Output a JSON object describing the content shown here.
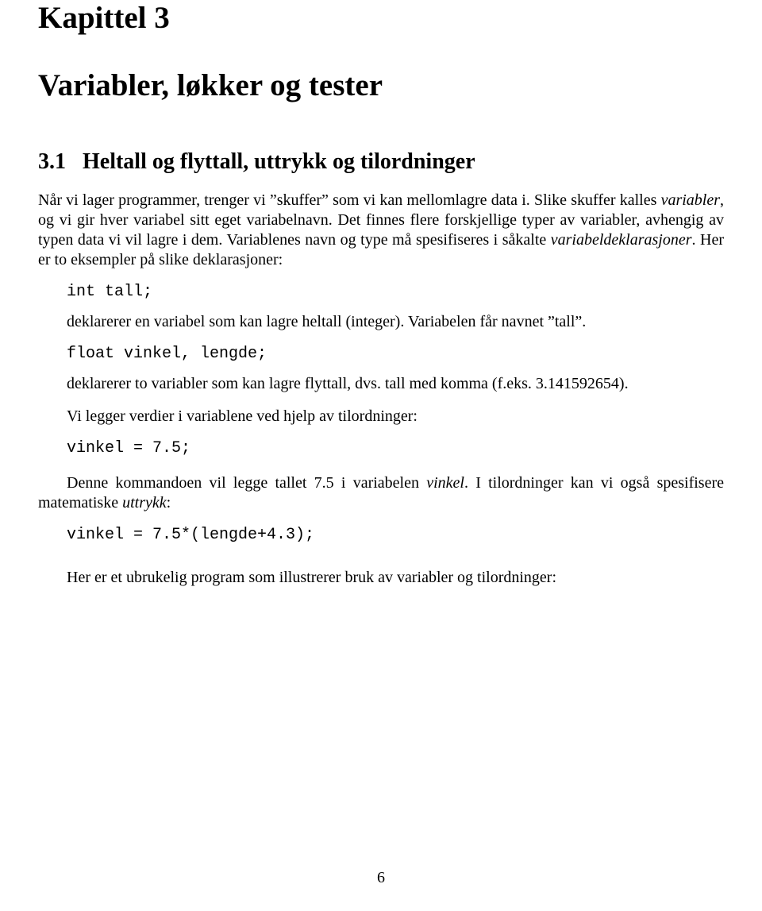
{
  "chapter": {
    "label": "Kapittel 3",
    "title": "Variabler, løkker og tester"
  },
  "section": {
    "number": "3.1",
    "title": "Heltall og flyttall, uttrykk og tilordninger"
  },
  "para1_a": "Når vi lager programmer, trenger vi ”skuffer” som vi kan mellomlagre data i. Slike skuffer kalles ",
  "para1_b": "variabler",
  "para1_c": ", og vi gir hver variabel sitt eget variabelnavn. Det finnes flere forskjellige typer av variabler, avhengig av typen data vi vil lagre i dem. Variablenes navn og type må spesifiseres i såkalte ",
  "para1_d": "variabeldeklarasjoner",
  "para1_e": ". Her er to eksempler på slike deklarasjoner:",
  "code1": "int tall;",
  "para2": "deklarerer en variabel som kan lagre heltall (integer). Variabelen får navnet ”tall”.",
  "code2": "float vinkel, lengde;",
  "para3": "deklarerer to variabler som kan lagre flyttall, dvs. tall med komma (f.eks. 3.141592654).",
  "para4_a": "Vi legger verdier i variablene ved hjelp av ",
  "para4_b": "tilordninger",
  "para4_c": ":",
  "code3": "vinkel = 7.5;",
  "para5_a": "Denne kommandoen vil legge tallet 7.5 i variabelen ",
  "para5_b": "vinkel",
  "para5_c": ". I tilordninger kan vi også spesifisere matematiske ",
  "para5_d": "uttrykk",
  "para5_e": ":",
  "code4": "vinkel = 7.5*(lengde+4.3);",
  "para6": "Her er et ubrukelig program som illustrerer bruk av variabler og tilordninger:",
  "page_number": "6"
}
